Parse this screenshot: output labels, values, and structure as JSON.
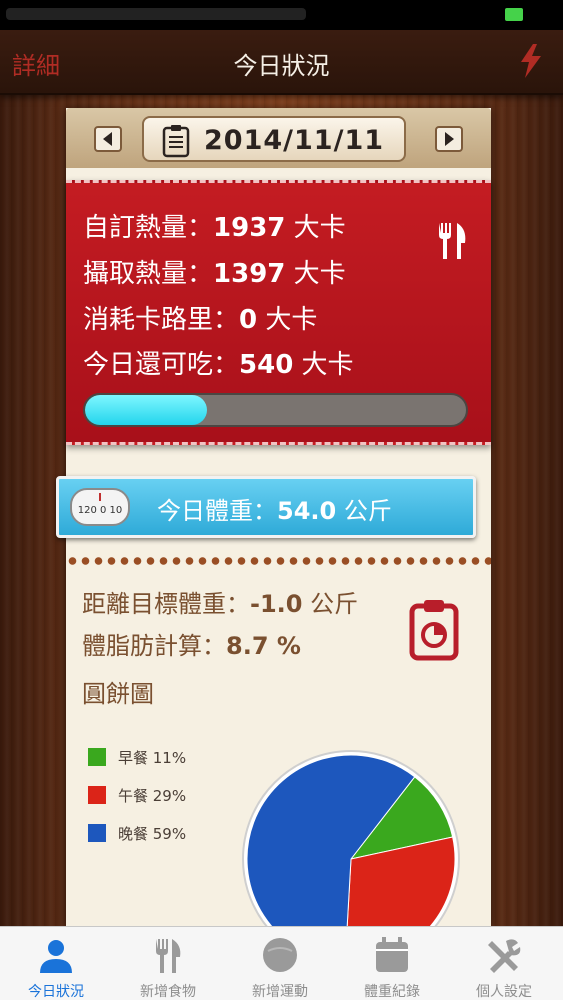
{
  "nav": {
    "left_label": "詳細",
    "title": "今日狀況"
  },
  "date": {
    "value": "2014/11/11"
  },
  "calories": {
    "lines": [
      {
        "label": "自訂熱量：",
        "value": "1937",
        "unit": " 大卡"
      },
      {
        "label": "攝取熱量：",
        "value": "1397",
        "unit": " 大卡"
      },
      {
        "label": "消耗卡路里：",
        "value": "0",
        "unit": " 大卡"
      },
      {
        "label": "今日還可吃：",
        "value": "540",
        "unit": " 大卡"
      }
    ],
    "progress_fraction": 0.32
  },
  "weight": {
    "label": "今日體重：",
    "value": "54.0",
    "unit": " 公斤",
    "scale_text": "120 0 10"
  },
  "goal": {
    "distance_label": "距離目標體重：",
    "distance_value": "-1.0",
    "distance_unit": " 公斤",
    "bodyfat_label": "體脂肪計算：",
    "bodyfat_value": "8.7 %",
    "pie_title": "圓餅圖"
  },
  "colors": {
    "breakfast": "#3aa81e",
    "lunch": "#db2418",
    "dinner": "#1d57bd"
  },
  "chart_data": {
    "type": "pie",
    "slices": [
      {
        "label": "早餐",
        "percent": 11
      },
      {
        "label": "午餐",
        "percent": 29
      },
      {
        "label": "晚餐",
        "percent": 59
      }
    ],
    "legend": [
      {
        "label": "早餐 11%"
      },
      {
        "label": "午餐 29%"
      },
      {
        "label": "晚餐 59%"
      }
    ]
  },
  "tabs": [
    {
      "label": "今日狀況",
      "icon": "person-icon",
      "active": true
    },
    {
      "label": "新增食物",
      "icon": "fork-knife-icon",
      "active": false
    },
    {
      "label": "新增運動",
      "icon": "exercise-icon",
      "active": false
    },
    {
      "label": "體重紀錄",
      "icon": "calendar-icon",
      "active": false
    },
    {
      "label": "個人設定",
      "icon": "tools-icon",
      "active": false
    }
  ]
}
